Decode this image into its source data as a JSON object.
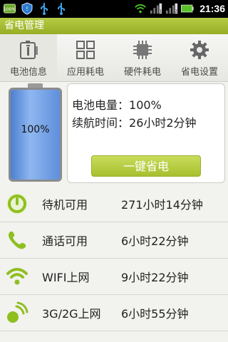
{
  "status_bar": {
    "time": "21:36",
    "battery_icon_text": "100%",
    "left_icons": [
      "battery-small-icon",
      "shield-icon",
      "usb-icon",
      "usb-icon"
    ],
    "right_icons": [
      "wifi-icon",
      "signal-1-icon",
      "signal-2-icon",
      "battery-icon"
    ]
  },
  "app": {
    "title": "省电管理"
  },
  "tabs": [
    {
      "label": "电池信息",
      "icon": "battery-info-icon",
      "active": true
    },
    {
      "label": "应用耗电",
      "icon": "apps-grid-icon",
      "active": false
    },
    {
      "label": "硬件耗电",
      "icon": "chip-icon",
      "active": false
    },
    {
      "label": "省电设置",
      "icon": "gear-icon",
      "active": false
    }
  ],
  "battery": {
    "percent_text": "100%",
    "level": 1.0
  },
  "info": {
    "level_label": "电池电量：",
    "level_value": "100%",
    "time_label": "续航时间：",
    "time_value": "26小时2分钟",
    "save_button": "一键省电"
  },
  "list": [
    {
      "icon": "power-standby-icon",
      "label": "待机可用",
      "value": "271小时14分钟"
    },
    {
      "icon": "phone-icon",
      "label": "通话可用",
      "value": "6小时22分钟"
    },
    {
      "icon": "wifi-icon",
      "label": "WIFI上网",
      "value": "9小时22分钟"
    },
    {
      "icon": "mobile-data-icon",
      "label": "3G/2G上网",
      "value": "6小时55分钟"
    }
  ],
  "colors": {
    "accent": "#a3bb2c",
    "battery_fill": "#5e8fdc",
    "icon_green": "#8fbf1f"
  }
}
